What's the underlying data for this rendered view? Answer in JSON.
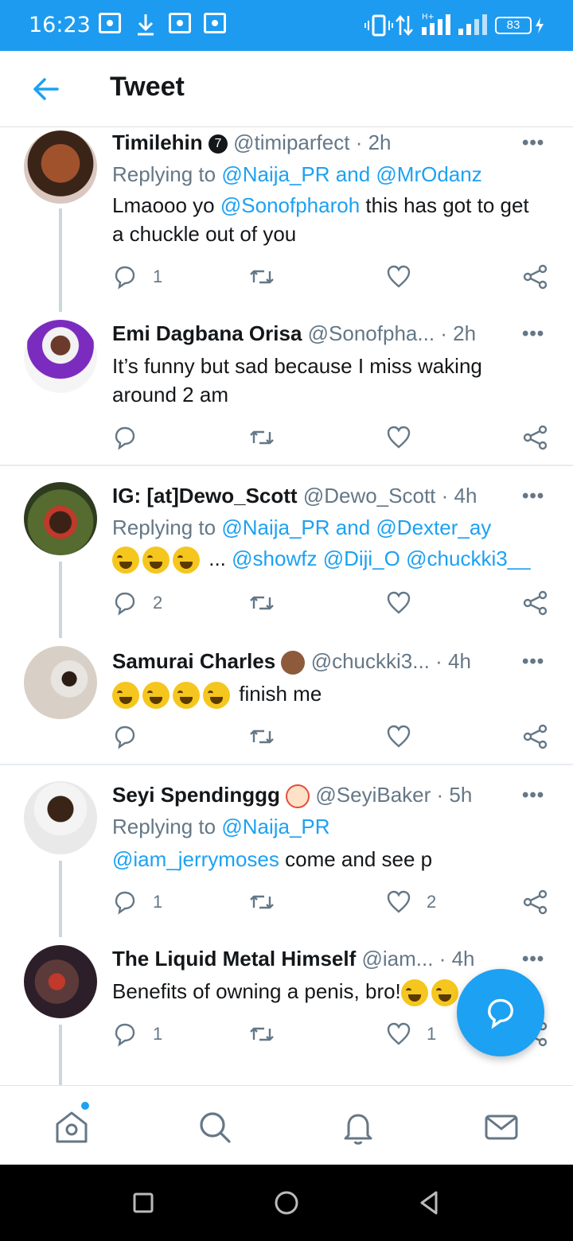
{
  "status_bar": {
    "time": "16:23",
    "network": "H+",
    "battery": "83"
  },
  "header": {
    "title": "Tweet"
  },
  "tweets": [
    {
      "name": "Timilehin",
      "badge": "7",
      "handle": "@timiparfect",
      "time": "· 2h",
      "reply_prefix": "Replying to ",
      "reply_users": [
        "@Naija_PR",
        "and",
        "@MrOdanz"
      ],
      "body_parts": [
        "Lmaooo yo ",
        "@Sonofpharoh",
        " this has got to get a chuckle out of you"
      ],
      "replies": "1",
      "likes": ""
    },
    {
      "name": "Emi Dagbana Orisa",
      "handle": "@Sonofpha...",
      "time": "· 2h",
      "body": "It’s funny but sad because I miss waking around 2 am",
      "replies": "",
      "likes": ""
    },
    {
      "name": "IG: [at]Dewo_Scott",
      "handle": "@Dewo_Scott",
      "time": "· 4h",
      "reply_prefix": "Replying to ",
      "reply_users": [
        "@Naija_PR",
        "and",
        "@Dexter_ay"
      ],
      "body_parts": [
        "...",
        "@showfz",
        "@Diji_O",
        "@chuckki3__"
      ],
      "replies": "2",
      "likes": ""
    },
    {
      "name": "Samurai Charles",
      "handle": "@chuckki3...",
      "time": "· 4h",
      "body": "finish me",
      "replies": "",
      "likes": ""
    },
    {
      "name": "Seyi Spendinggg",
      "handle": "@SeyiBaker",
      "time": "· 5h",
      "reply_prefix": "Replying to ",
      "reply_users": [
        "@Naija_PR"
      ],
      "body_parts": [
        "@iam_jerrymoses",
        " come and see p"
      ],
      "replies": "1",
      "likes": "2"
    },
    {
      "name": "The Liquid Metal Himself",
      "handle": "@iam...",
      "time": "· 4h",
      "body": "Benefits of owning a penis, bro!",
      "replies": "1",
      "likes": "1"
    }
  ],
  "more_label": "•••",
  "colors": {
    "accent": "#1da1f2",
    "statusbar": "#1d9bf0",
    "secondary_text": "#657786"
  }
}
